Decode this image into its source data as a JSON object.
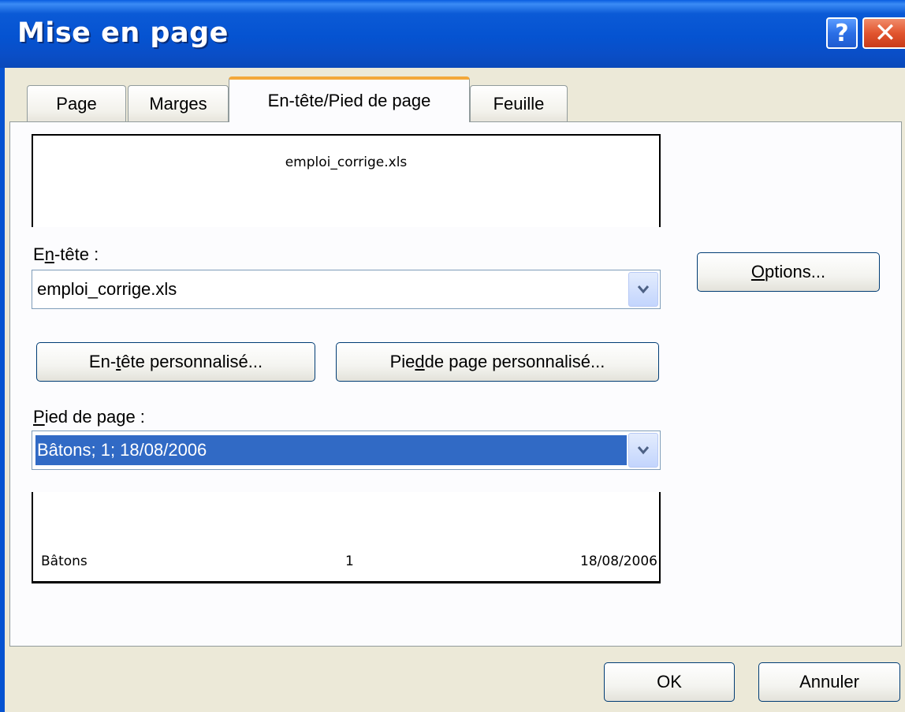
{
  "window": {
    "title": "Mise en page",
    "help_glyph": "?",
    "close_glyph": "✕"
  },
  "tabs": [
    {
      "label": "Page"
    },
    {
      "label": "Marges"
    },
    {
      "label": "En-tête/Pied de page",
      "active": true
    },
    {
      "label": "Feuille"
    }
  ],
  "header_preview": {
    "center": "emploi_corrige.xls"
  },
  "header": {
    "label_prefix": "E",
    "label_u": "n",
    "label_suffix": "-tête :",
    "value": "emploi_corrige.xls"
  },
  "buttons": {
    "custom_header": {
      "prefix": "En-",
      "u": "t",
      "suffix": "ête personnalisé..."
    },
    "custom_footer": {
      "prefix": "Pie",
      "u": "d",
      "suffix": " de page personnalisé..."
    },
    "options": {
      "prefix": "",
      "u": "O",
      "suffix": "ptions..."
    },
    "ok": "OK",
    "cancel": "Annuler"
  },
  "footer": {
    "label_u": "P",
    "label_suffix": "ied de page :",
    "value": "Bâtons; 1; 18/08/2006"
  },
  "footer_preview": {
    "left": "Bâtons",
    "center": "1",
    "right": "18/08/2006"
  },
  "colors": {
    "titlebar": "#0553d1",
    "selection": "#316ac5",
    "active_tab_accent": "#f3a83a"
  }
}
